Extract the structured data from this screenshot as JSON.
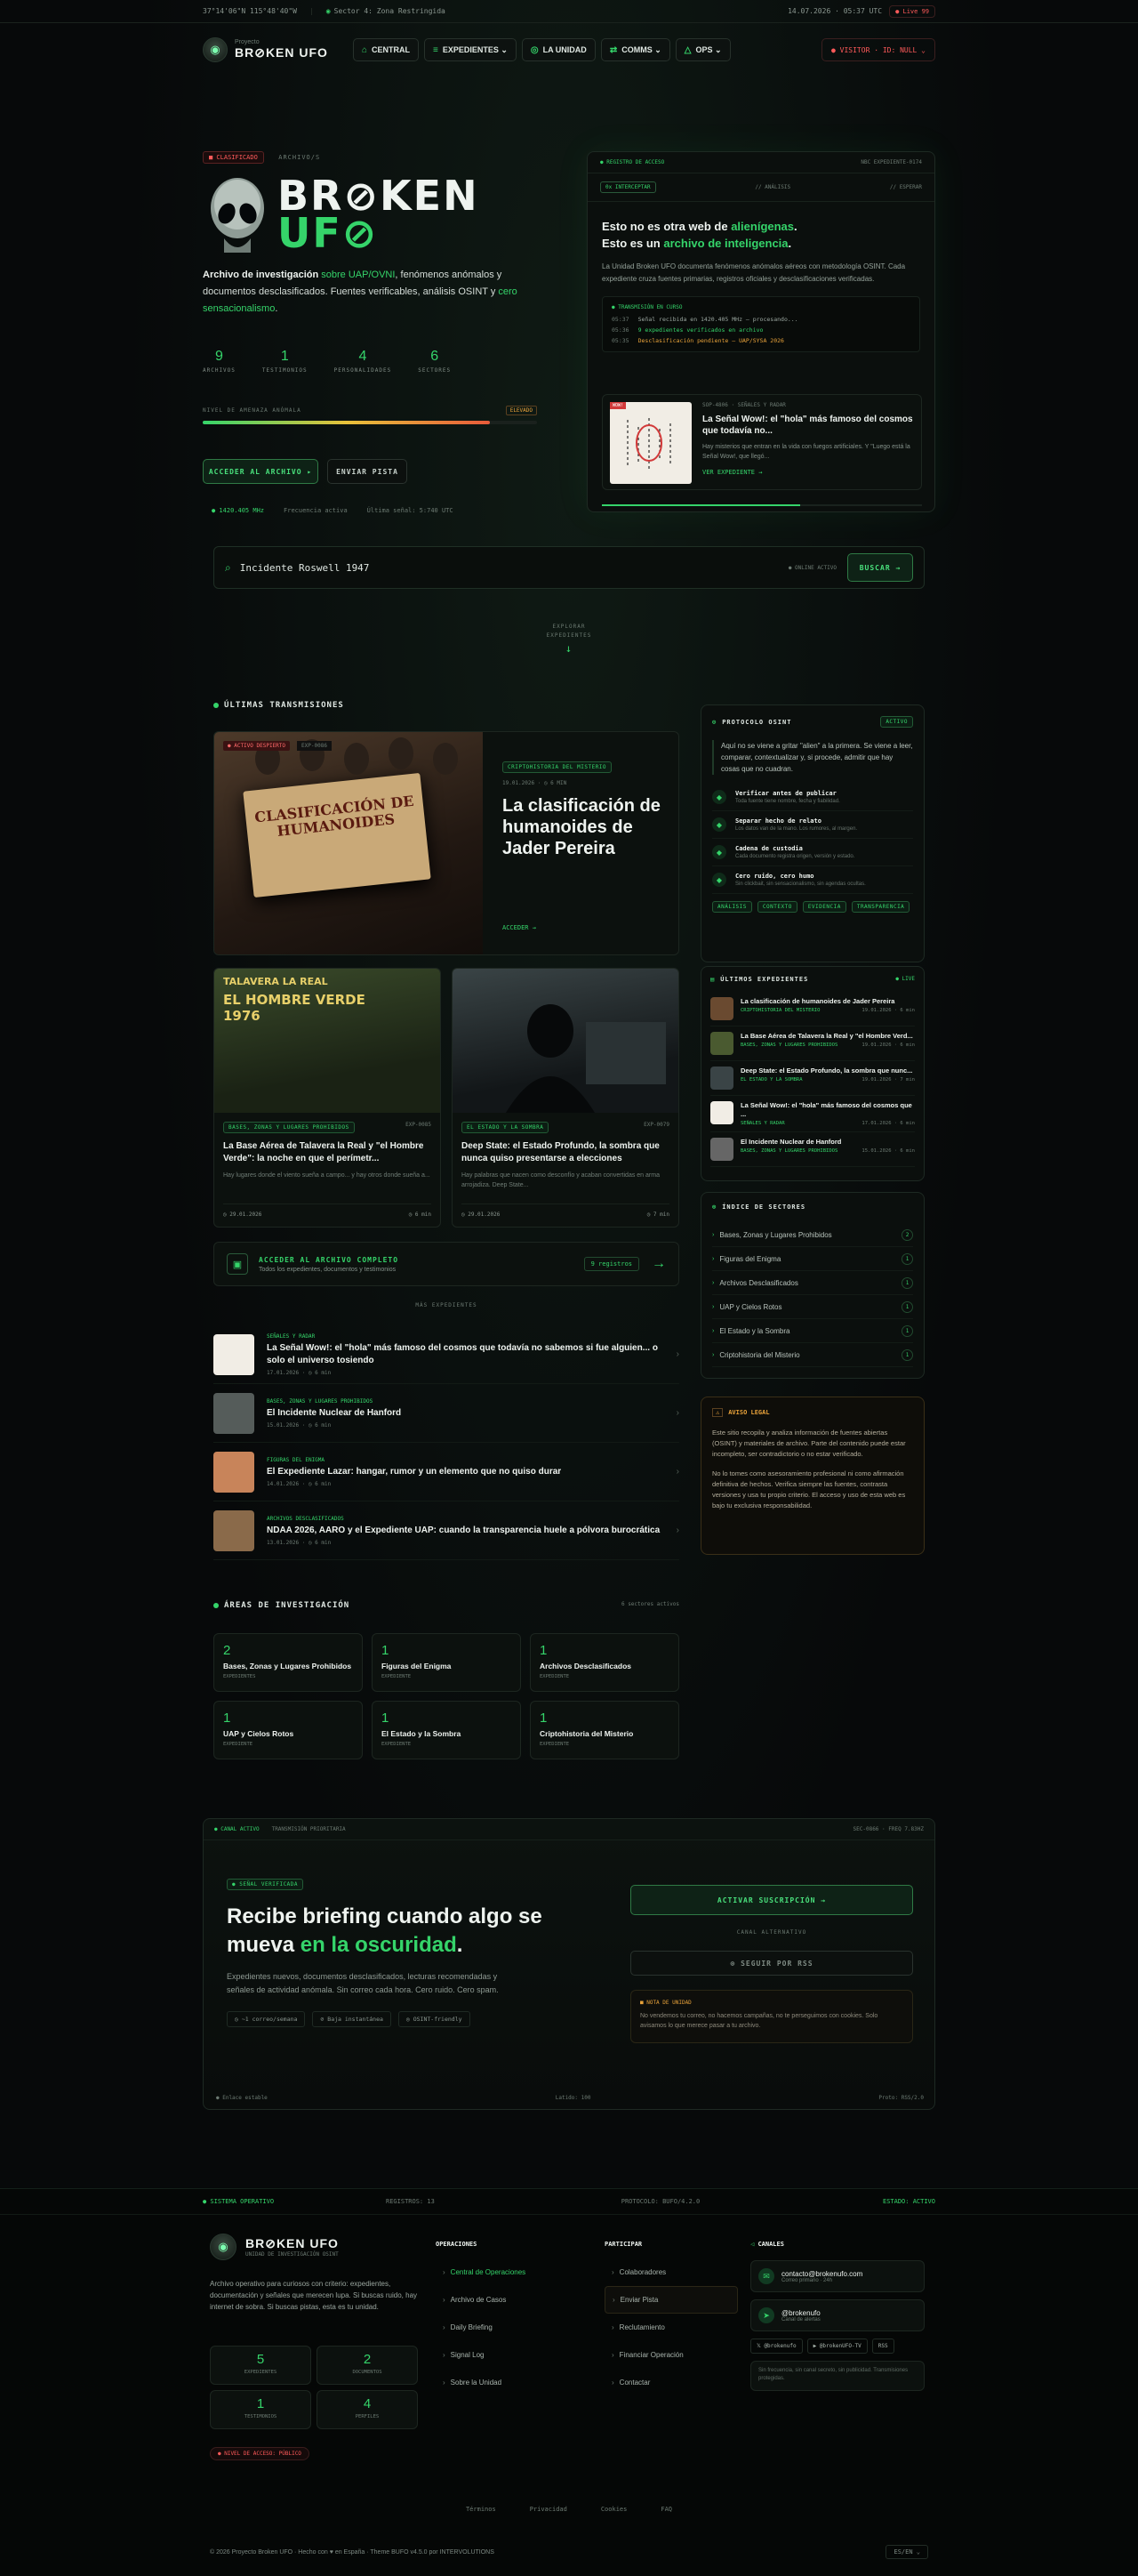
{
  "topbar": {
    "coords": "37°14'06\"N 115°48'40\"W",
    "sector": "Sector 4: Zona Restringida",
    "utc": "14.07.2026 · 05:37 UTC",
    "live": "● Live 99"
  },
  "nav": {
    "brand_small": "Proyecto",
    "brand_big": "BR⊘KEN UFO",
    "items": [
      {
        "icon": "⌂",
        "label": "CENTRAL"
      },
      {
        "icon": "≡",
        "label": "EXPEDIENTES ⌄"
      },
      {
        "icon": "◎",
        "label": "LA UNIDAD"
      },
      {
        "icon": "⇄",
        "label": "COMMS ⌄"
      },
      {
        "icon": "△",
        "label": "OPS ⌄"
      }
    ],
    "visitor": "● VISITOR · ID: NULL ⌄"
  },
  "hero": {
    "badge": "■ CLASIFICADO",
    "archive": "ARCHIVO/S",
    "title1": "BR⊘KEN",
    "title2": "UF⊘",
    "desc_pre": "Archivo de investigación ",
    "desc_g1": "sobre UAP/OVNI",
    "desc_mid": ", fenómenos anómalos y documentos desclasificados. Fuentes verificables, análisis OSINT y ",
    "desc_g2": "cero sensacionalismo",
    "desc_end": ".",
    "stats": [
      {
        "n": "9",
        "l": "ARCHIVOS"
      },
      {
        "n": "1",
        "l": "TESTIMONIOS"
      },
      {
        "n": "4",
        "l": "PERSONALIDADES"
      },
      {
        "n": "6",
        "l": "SECTORES"
      }
    ],
    "risk_label": "NIVEL DE AMENAZA ANÓMALA",
    "risk_badge": "ELEVADO",
    "risk_level": 0.86,
    "btn_primary": "ACCEDER AL ARCHIVO ▸",
    "btn_secondary": "ENVIAR PISTA",
    "signal": "● 1420.405 MHz",
    "signal2": "Frecuencia activa",
    "signal3": "Última señal: 5:740 UTC"
  },
  "terminal": {
    "head_l": "● REGISTRO DE ACCESO",
    "head_r": "NBC EXPEDIENTE-0174",
    "sub1": "0x INTERCEPTAR",
    "sub2": "// ANÁLISIS",
    "sub3": "// ESPERAR",
    "q1_pre": "Esto no es otra web de ",
    "q1_g": "alienígenas",
    "q1_end": ".",
    "q2_pre": "Esto es un ",
    "q2_g": "archivo de inteligencia",
    "q2_end": ".",
    "body": "La Unidad Broken UFO documenta fenómenos anómalos aéreos con metodología OSINT. Cada expediente cruza fuentes primarias, registros oficiales y desclasificaciones verificadas.",
    "log_title": "● TRANSMISIÓN EN CURSO",
    "logs": [
      {
        "t": "05:37",
        "m": "Señal recibida en 1420.405 MHz — procesando..."
      },
      {
        "t": "05:36",
        "m": "9 expedientes verificados en archivo"
      },
      {
        "t": "05:35",
        "m": "Desclasificación pendiente — UAP/SYSA 2026"
      }
    ],
    "feat_tags": "SOP-4806 · SEÑALES Y RADAR",
    "feat_title": "La Señal Wow!: el \"hola\" más famoso del cosmos que todavía no...",
    "feat_desc": "Hay misterios que entran en la vida con fuegos artificiales. Y \"Luego está la Señal Wow!, que llegó...",
    "feat_more": "VER EXPEDIENTE →"
  },
  "search": {
    "placeholder": "Incidente Roswell 1947",
    "status": "● ONLINE ACTIVO",
    "button": "BUSCAR →"
  },
  "explore": {
    "l1": "EXPLORAR",
    "l2": "EXPEDIENTES",
    "arrow": "↓"
  },
  "latest": {
    "title": "ÚLTIMAS TRANSMISIONES",
    "main": {
      "badge": "● ACTIVO DESPIERTO",
      "code": "EXP-0086",
      "img_text": "CLASIFICACIÓN DE HUMANOIDES",
      "tag": "CRIPTOHISTORIA DEL MISTERIO",
      "date": "19.01.2026 · ◷ 6 MIN",
      "title": "La clasificación de humanoides de Jader Pereira",
      "link": "ACCEDER →"
    },
    "cards": [
      {
        "img_text1": "TALAVERA LA REAL",
        "img_text2": "EL HOMBRE VERDE",
        "img_text3": "1976",
        "tag": "BASES, ZONAS Y LUGARES PROHIBIDOS",
        "code": "EXP-0085",
        "title": "La Base Aérea de Talavera la Real y \"el Hombre Verde\": la noche en que el perímetr...",
        "desc": "Hay lugares donde el viento sueña a campo... y hay otros donde sueña a...",
        "date": "◷ 29.01.2026",
        "read": "◷ 6 min"
      },
      {
        "tag": "EL ESTADO Y LA SOMBRA",
        "code": "EXP-0079",
        "title": "Deep State: el Estado Profundo, la sombra que nunca quiso presentarse a elecciones",
        "desc": "Hay palabras que nacen como desconfío y acaban convertidas en arma arrojadiza. Deep State...",
        "date": "◷ 29.01.2026",
        "read": "◷ 7 min"
      }
    ],
    "full": {
      "title": "ACCEDER AL ARCHIVO COMPLETO",
      "sub": "Todos los expedientes, documentos y testimonios",
      "count": "9 registros",
      "arrow": "→"
    },
    "more_title": "MÁS EXPEDIENTES",
    "list": [
      {
        "cat": "SEÑALES Y RADAR",
        "title": "La Señal Wow!: el \"hola\" más famoso del cosmos que todavía no sabemos si fue alguien... o solo el universo tosiendo",
        "meta": "17.01.2026 · ◷ 6 min"
      },
      {
        "cat": "BASES, ZONAS Y LUGARES PROHIBIDOS",
        "title": "El Incidente Nuclear de Hanford",
        "meta": "15.01.2026 · ◷ 6 min"
      },
      {
        "cat": "FIGURAS DEL ENIGMA",
        "title": "El Expediente Lazar: hangar, rumor y un elemento que no quiso durar",
        "meta": "14.01.2026 · ◷ 6 min"
      },
      {
        "cat": "ARCHIVOS DESCLASIFICADOS",
        "title": "NDAA 2026, AARO y el Expediente UAP: cuando la transparencia huele a pólvora burocrática",
        "meta": "13.01.2026 · ◷ 6 min"
      }
    ]
  },
  "protocol": {
    "title": "PROTOCOLO OSINT",
    "status": "ACTIVO",
    "intro": "Aquí no se viene a gritar \"alien\" a la primera. Se viene a leer, comparar, contextualizar y, si procede, admitir que hay cosas que no cuadran.",
    "items": [
      {
        "t": "Verificar antes de publicar",
        "d": "Toda fuente tiene nombre, fecha y fiabilidad."
      },
      {
        "t": "Separar hecho de relato",
        "d": "Los datos van de la mano. Los rumores, al margen."
      },
      {
        "t": "Cadena de custodia",
        "d": "Cada documento registra origen, versión y estado."
      },
      {
        "t": "Cero ruido, cero humo",
        "d": "Sin clickbait, sin sensacionalismo, sin agendas ocultas."
      }
    ],
    "tags": [
      "ANÁLISIS",
      "CONTEXTO",
      "EVIDENCIA",
      "TRANSPARENCIA"
    ]
  },
  "side_latest": {
    "title": "ÚLTIMOS EXPEDIENTES",
    "live": "● LIVE",
    "items": [
      {
        "t": "La clasificación de humanoides de Jader Pereira",
        "c": "CRIPTOHISTORIA DEL MISTERIO",
        "d": "19.01.2026 · 6 min"
      },
      {
        "t": "La Base Aérea de Talavera la Real y \"el Hombre Verd...",
        "c": "BASES, ZONAS Y LUGARES PROHIBIDOS",
        "d": "19.01.2026 · 6 min"
      },
      {
        "t": "Deep State: el Estado Profundo, la sombra que nunc...",
        "c": "EL ESTADO Y LA SOMBRA",
        "d": "19.01.2026 · 7 min"
      },
      {
        "t": "La Señal Wow!: el \"hola\" más famoso del cosmos que ...",
        "c": "SEÑALES Y RADAR",
        "d": "17.01.2026 · 6 min"
      },
      {
        "t": "El Incidente Nuclear de Hanford",
        "c": "BASES, ZONAS Y LUGARES PROHIBIDOS",
        "d": "15.01.2026 · 6 min"
      }
    ]
  },
  "sectors": {
    "title": "ÍNDICE DE SECTORES",
    "items": [
      {
        "n": "Bases, Zonas y Lugares Prohibidos",
        "c": "2"
      },
      {
        "n": "Figuras del Enigma",
        "c": "1"
      },
      {
        "n": "Archivos Desclasificados",
        "c": "1"
      },
      {
        "n": "UAP y Cielos Rotos",
        "c": "1"
      },
      {
        "n": "El Estado y la Sombra",
        "c": "1"
      },
      {
        "n": "Criptohistoria del Misterio",
        "c": "1"
      }
    ]
  },
  "legal": {
    "title": "AVISO LEGAL",
    "p1": "Este sitio recopila y analiza información de fuentes abiertas (OSINT) y materiales de archivo. Parte del contenido puede estar incompleto, ser contradictorio o no estar verificado.",
    "p2": "No lo tomes como asesoramiento profesional ni como afirmación definitiva de hechos. Verifica siempre las fuentes, contrasta versiones y usa tu propio criterio. El acceso y uso de esta web es bajo tu exclusiva responsabilidad."
  },
  "areas": {
    "title": "ÁREAS DE INVESTIGACIÓN",
    "count": "6 sectores activos",
    "items": [
      {
        "n": "2",
        "t": "Bases, Zonas y Lugares Prohibidos",
        "l": "EXPEDIENTES"
      },
      {
        "n": "1",
        "t": "Figuras del Enigma",
        "l": "EXPEDIENTE"
      },
      {
        "n": "1",
        "t": "Archivos Desclasificados",
        "l": "EXPEDIENTE"
      },
      {
        "n": "1",
        "t": "UAP y Cielos Rotos",
        "l": "EXPEDIENTE"
      },
      {
        "n": "1",
        "t": "El Estado y la Sombra",
        "l": "EXPEDIENTE"
      },
      {
        "n": "1",
        "t": "Criptohistoria del Misterio",
        "l": "EXPEDIENTE"
      }
    ]
  },
  "newsletter": {
    "h_l": "● CANAL ACTIVO",
    "h_l2": "TRANSMISIÓN PRIORITARIA",
    "h_r": "SEC-0866 · FREQ 7.83HZ",
    "badge": "● SEÑAL VERIFICADA",
    "t1": "Recibe briefing cuando algo se",
    "t2_pre": "mueva ",
    "t2_g": "en la oscuridad",
    "t2_end": ".",
    "desc": "Expedientes nuevos, documentos desclasificados, lecturas recomendadas y señales de actividad anómala. Sin correo cada hora. Cero ruido. Cero spam.",
    "chips": [
      "◷ ~1 correo/semana",
      "⊘ Baja instantánea",
      "◎ OSINT-friendly"
    ],
    "btn": "ACTIVAR SUSCRIPCIÓN →",
    "alt": "CANAL ALTERNATIVO",
    "rss": "⊚ SEGUIR POR RSS",
    "note_t": "■ NOTA DE UNIDAD",
    "note": "No vendemos tu correo, no hacemos campañas, no te perseguimos con cookies. Solo avisamos lo que merece pasar a tu archivo.",
    "f_l": "● Enlace estable",
    "f_m": "Latido: 100",
    "f_r": "Proto: RSS/2.0"
  },
  "footer": {
    "strip_l": "● SISTEMA OPERATIVO",
    "strip_m": "REGISTROS: 13",
    "strip_p": "PROTOCOLO: BUFO/4.2.0",
    "strip_r": "ESTADO: ACTIVO",
    "brand": "BR⊘KEN UFO",
    "brand_sub": "UNIDAD DE INVESTIGACIÓN OSINT",
    "desc": "Archivo operativo para curiosos con criterio: expedientes, documentación y señales que merecen lupa. Si buscas ruido, hay internet de sobra. Si buscas pistas, esta es tu unidad.",
    "stats": [
      {
        "n": "5",
        "l": "EXPEDIENTES"
      },
      {
        "n": "2",
        "l": "DOCUMENTOS"
      },
      {
        "n": "1",
        "l": "TESTIMONIOS"
      },
      {
        "n": "4",
        "l": "PERFILES"
      }
    ],
    "access": "● NIVEL DE ACCESO: PÚBLICO",
    "cols": [
      {
        "h": "OPERACIONES",
        "items": [
          "Central de Operaciones",
          "Archivo de Casos",
          "Daily Briefing",
          "Signal Log",
          "Sobre la Unidad"
        ]
      },
      {
        "h": "PARTICIPAR",
        "items": [
          "Colaboradores",
          "Enviar Pista",
          "Reclutamiento",
          "Financiar Operación",
          "Contactar"
        ]
      }
    ],
    "canales_h": "CANALES",
    "mail": "contacto@brokenufo.com",
    "mail_s": "Correo primario · 24h",
    "tg": "@brokenufo",
    "tg_s": "Canal de alertas",
    "socials": [
      "𝕏 @brokenufo",
      "▶ @brokenUFO-TV",
      "RSS"
    ],
    "sub_ph": "Sin frecuencia, sin canal secreto, sin publicidad. Transmisiones protegidas.",
    "legal_links": [
      "Términos",
      "Privacidad",
      "Cookies",
      "FAQ"
    ],
    "copy": "© 2026 Proyecto Broken UFO · Hecho con ♥ en España · Theme BUFO v4.5.0 por INTERVOLUTIONS",
    "lang": "ES/EN ⌄"
  }
}
